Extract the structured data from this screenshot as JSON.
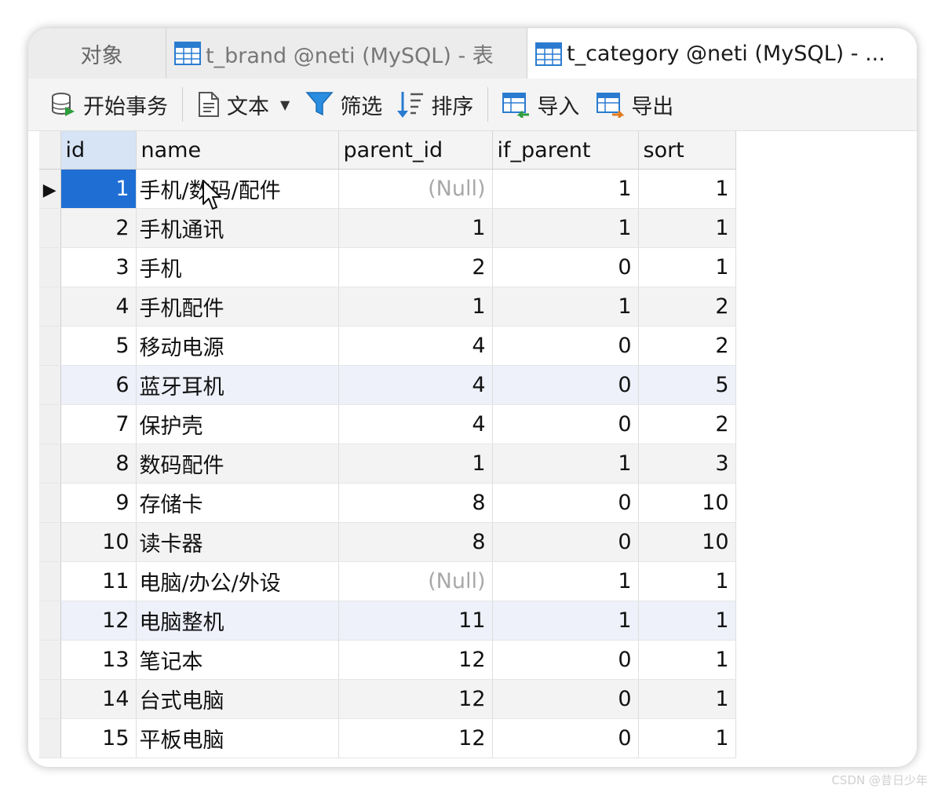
{
  "tabs": [
    {
      "label": "对象"
    },
    {
      "label": "t_brand @neti (MySQL) - 表"
    },
    {
      "label": "t_category @neti (MySQL) - ..."
    }
  ],
  "toolbar": {
    "begin_transaction": "开始事务",
    "text": "文本",
    "filter": "筛选",
    "sort": "排序",
    "import": "导入",
    "export": "导出"
  },
  "columns": [
    "id",
    "name",
    "parent_id",
    "if_parent",
    "sort"
  ],
  "rows": [
    {
      "id": "1",
      "name": "手机/数码/配件",
      "parent_id": "(Null)",
      "if_parent": "1",
      "sort": "1"
    },
    {
      "id": "2",
      "name": "手机通讯",
      "parent_id": "1",
      "if_parent": "1",
      "sort": "1"
    },
    {
      "id": "3",
      "name": "手机",
      "parent_id": "2",
      "if_parent": "0",
      "sort": "1"
    },
    {
      "id": "4",
      "name": "手机配件",
      "parent_id": "1",
      "if_parent": "1",
      "sort": "2"
    },
    {
      "id": "5",
      "name": "移动电源",
      "parent_id": "4",
      "if_parent": "0",
      "sort": "2"
    },
    {
      "id": "6",
      "name": "蓝牙耳机",
      "parent_id": "4",
      "if_parent": "0",
      "sort": "5"
    },
    {
      "id": "7",
      "name": "保护壳",
      "parent_id": "4",
      "if_parent": "0",
      "sort": "2"
    },
    {
      "id": "8",
      "name": "数码配件",
      "parent_id": "1",
      "if_parent": "1",
      "sort": "3"
    },
    {
      "id": "9",
      "name": "存储卡",
      "parent_id": "8",
      "if_parent": "0",
      "sort": "10"
    },
    {
      "id": "10",
      "name": "读卡器",
      "parent_id": "8",
      "if_parent": "0",
      "sort": "10"
    },
    {
      "id": "11",
      "name": "电脑/办公/外设",
      "parent_id": "(Null)",
      "if_parent": "1",
      "sort": "1"
    },
    {
      "id": "12",
      "name": "电脑整机",
      "parent_id": "11",
      "if_parent": "1",
      "sort": "1"
    },
    {
      "id": "13",
      "name": "笔记本",
      "parent_id": "12",
      "if_parent": "0",
      "sort": "1"
    },
    {
      "id": "14",
      "name": "台式电脑",
      "parent_id": "12",
      "if_parent": "0",
      "sort": "1"
    },
    {
      "id": "15",
      "name": "平板电脑",
      "parent_id": "12",
      "if_parent": "0",
      "sort": "1"
    }
  ],
  "selected_row_marker": "▶",
  "watermark": "CSDN @昔日少年",
  "colors": {
    "selection": "#1f6ed4",
    "null_text": "#a8a8a8",
    "icon_blue": "#2a7bd0"
  }
}
